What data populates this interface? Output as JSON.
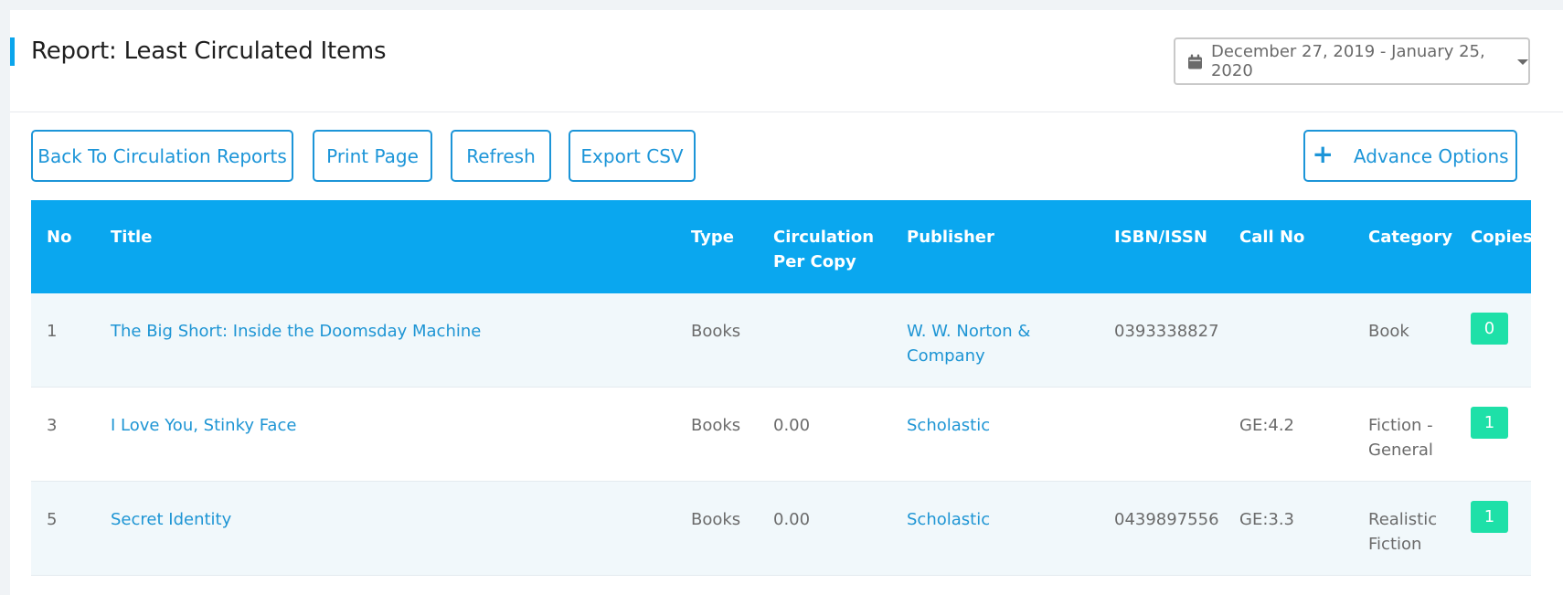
{
  "header": {
    "title": "Report: Least Circulated Items",
    "date_range": "December 27, 2019 - January 25, 2020"
  },
  "actions": {
    "back": "Back To Circulation Reports",
    "print": "Print Page",
    "refresh": "Refresh",
    "export": "Export CSV",
    "advance_plus": "+",
    "advance": "Advance Options"
  },
  "table": {
    "columns": {
      "no": "No",
      "title": "Title",
      "type": "Type",
      "circ1": "Circulation",
      "circ2": "Per Copy",
      "publisher": "Publisher",
      "isbn": "ISBN/ISSN",
      "callno": "Call No",
      "category": "Category",
      "copies": "Copies"
    },
    "rows": [
      {
        "no": "1",
        "title": "The Big Short: Inside the Doomsday Machine",
        "type": "Books",
        "circ": "",
        "publisher1": "W. W. Norton &",
        "publisher2": "Company",
        "isbn": "0393338827",
        "callno": "",
        "category1": "Book",
        "category2": "",
        "copies": "0"
      },
      {
        "no": "3",
        "title": "I Love You, Stinky Face",
        "type": "Books",
        "circ": "0.00",
        "publisher1": "Scholastic",
        "publisher2": "",
        "isbn": "",
        "callno": "GE:4.2",
        "category1": "Fiction -",
        "category2": "General",
        "copies": "1"
      },
      {
        "no": "5",
        "title": "Secret Identity",
        "type": "Books",
        "circ": "0.00",
        "publisher1": "Scholastic",
        "publisher2": "",
        "isbn": "0439897556",
        "callno": "GE:3.3",
        "category1": "Realistic",
        "category2": "Fiction",
        "copies": "1"
      }
    ]
  }
}
